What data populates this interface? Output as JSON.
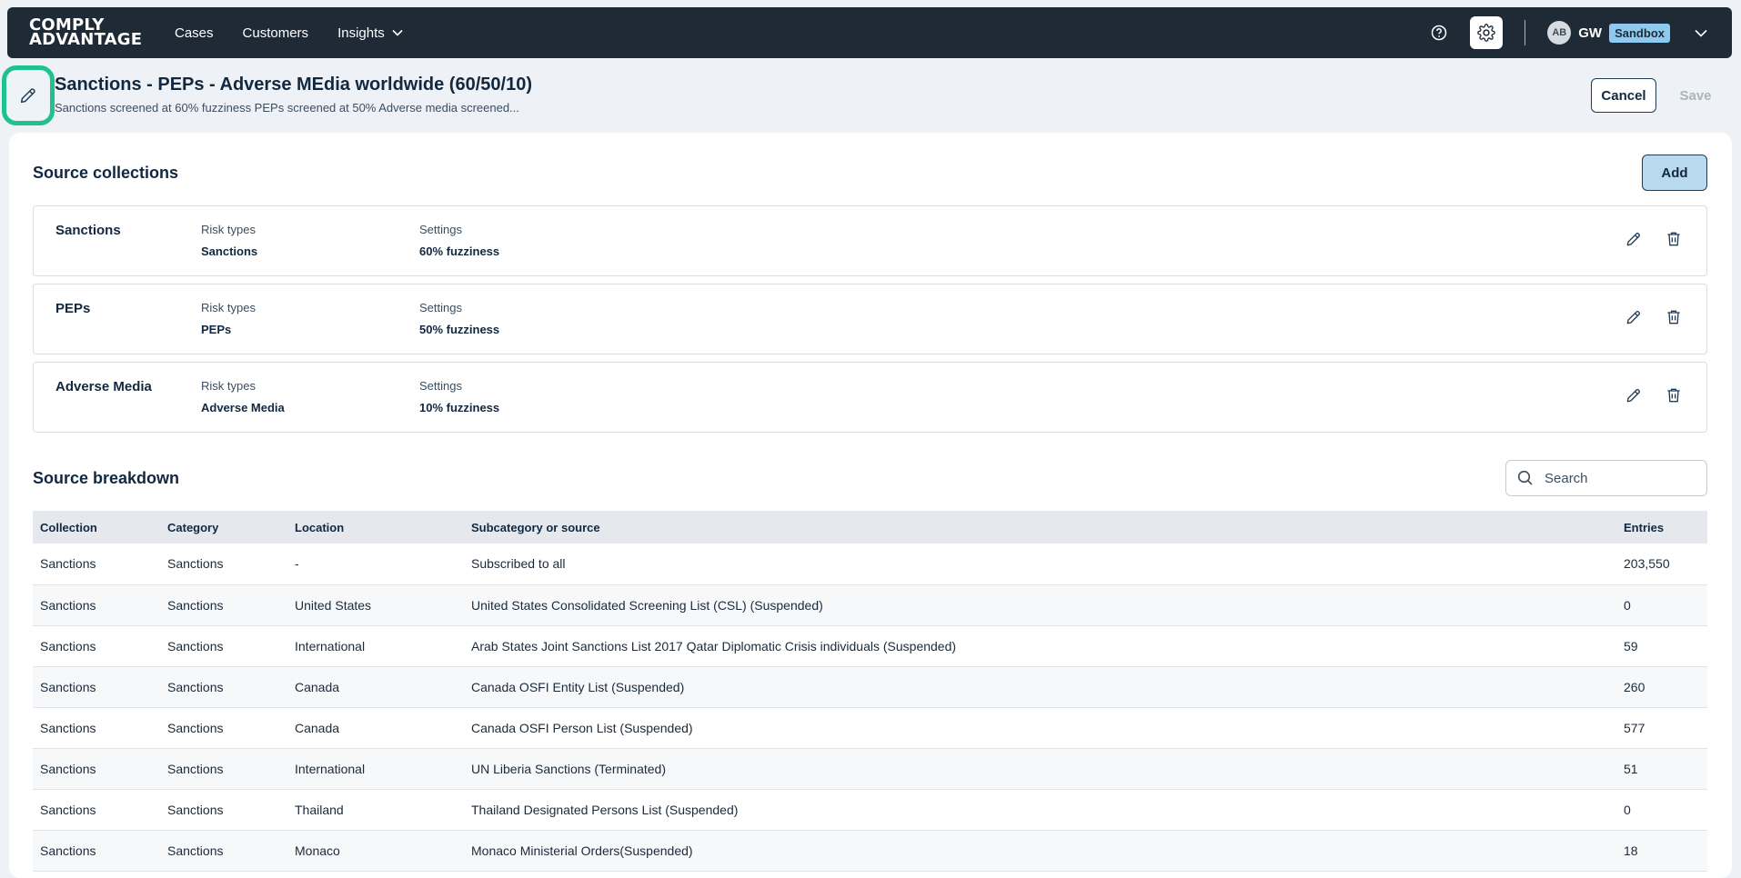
{
  "nav": {
    "logo_line1": "COMPLY",
    "logo_line2": "ADVANTAGE",
    "items": [
      "Cases",
      "Customers",
      "Insights"
    ],
    "avatar": "AB",
    "user": "GW",
    "environment": "Sandbox"
  },
  "header": {
    "title": "Sanctions - PEPs - Adverse MEdia worldwide (60/50/10)",
    "subtitle": "Sanctions screened at 60% fuzziness PEPs screened at 50% Adverse media screened...",
    "cancel_label": "Cancel",
    "save_label": "Save"
  },
  "source_collections": {
    "title": "Source collections",
    "add_label": "Add",
    "risk_types_label": "Risk types",
    "settings_label": "Settings",
    "items": [
      {
        "name": "Sanctions",
        "risk_types": "Sanctions",
        "settings": "60% fuzziness"
      },
      {
        "name": "PEPs",
        "risk_types": "PEPs",
        "settings": "50% fuzziness"
      },
      {
        "name": "Adverse Media",
        "risk_types": "Adverse Media",
        "settings": "10% fuzziness"
      }
    ]
  },
  "source_breakdown": {
    "title": "Source breakdown",
    "search_placeholder": "Search",
    "columns": [
      "Collection",
      "Category",
      "Location",
      "Subcategory or source",
      "Entries"
    ],
    "rows": [
      [
        "Sanctions",
        "Sanctions",
        "-",
        "Subscribed to all",
        "203,550"
      ],
      [
        "Sanctions",
        "Sanctions",
        "United States",
        "United States Consolidated Screening List (CSL) (Suspended)",
        "0"
      ],
      [
        "Sanctions",
        "Sanctions",
        "International",
        "Arab States Joint Sanctions List 2017 Qatar Diplomatic Crisis individuals (Suspended)",
        "59"
      ],
      [
        "Sanctions",
        "Sanctions",
        "Canada",
        "Canada OSFI Entity List (Suspended)",
        "260"
      ],
      [
        "Sanctions",
        "Sanctions",
        "Canada",
        "Canada OSFI Person List (Suspended)",
        "577"
      ],
      [
        "Sanctions",
        "Sanctions",
        "International",
        "UN Liberia Sanctions (Terminated)",
        "51"
      ],
      [
        "Sanctions",
        "Sanctions",
        "Thailand",
        "Thailand Designated Persons List (Suspended)",
        "0"
      ],
      [
        "Sanctions",
        "Sanctions",
        "Monaco",
        "Monaco Ministerial Orders(Suspended)",
        "18"
      ]
    ]
  }
}
